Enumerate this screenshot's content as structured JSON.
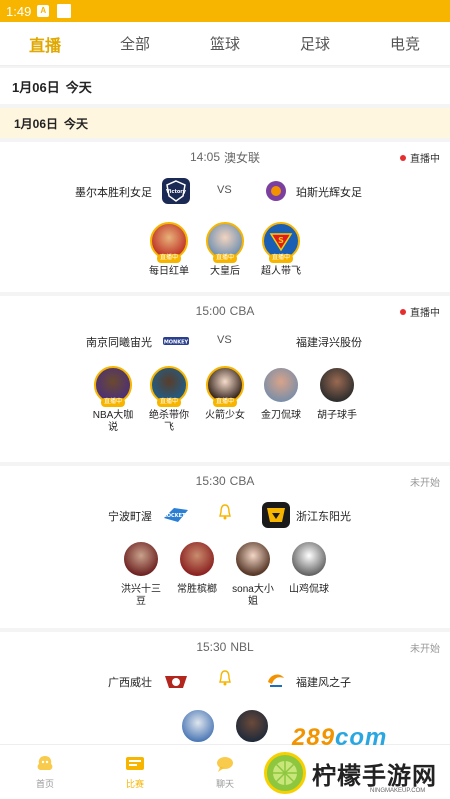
{
  "status_bar": {
    "time": "1:49",
    "icon_letter": "A"
  },
  "tabs": [
    {
      "label": "直播",
      "active": true
    },
    {
      "label": "全部",
      "active": false
    },
    {
      "label": "篮球",
      "active": false
    },
    {
      "label": "足球",
      "active": false
    },
    {
      "label": "电竞",
      "active": false
    }
  ],
  "date_header": {
    "date": "1月06日",
    "day": "今天"
  },
  "date_sub": {
    "date": "1月06日",
    "day": "今天"
  },
  "matches": [
    {
      "time": "14:05",
      "league": "澳女联",
      "status": "直播中",
      "home": "墨尔本胜利女足",
      "away": "珀斯光辉女足",
      "center": "VS",
      "anchors": [
        "每日红单",
        "大皇后",
        "超人带飞"
      ]
    },
    {
      "time": "15:00",
      "league": "CBA",
      "status": "直播中",
      "home": "南京同曦宙光",
      "away": "福建浔兴股份",
      "center": "VS",
      "anchors": [
        "NBA大咖说",
        "绝杀带你飞",
        "火箭少女",
        "金刀侃球",
        "胡子球手"
      ]
    },
    {
      "time": "15:30",
      "league": "CBA",
      "status": "未开始",
      "home": "宁波町渥",
      "away": "浙江东阳光",
      "center": "bell",
      "anchors": [
        "洪兴十三豆",
        "常胜槟榔",
        "sona大小姐",
        "山鸡侃球"
      ]
    },
    {
      "time": "15:30",
      "league": "NBL",
      "status": "未开始",
      "home": "广西威壮",
      "away": "福建风之子",
      "center": "bell",
      "anchors": []
    }
  ],
  "live_tag": "直播中",
  "nav": [
    {
      "label": "首页",
      "icon": "home-icon"
    },
    {
      "label": "比赛",
      "icon": "match-icon"
    },
    {
      "label": "聊天",
      "icon": "chat-icon"
    }
  ],
  "watermark": {
    "top": "289",
    "top_suffix": "com",
    "text": "柠檬手游网",
    "url": "NINGMAKEUP.COM"
  },
  "colors": {
    "accent": "#f7b500",
    "live_dot": "#e62e2e",
    "active_tab": "#e0a800"
  }
}
